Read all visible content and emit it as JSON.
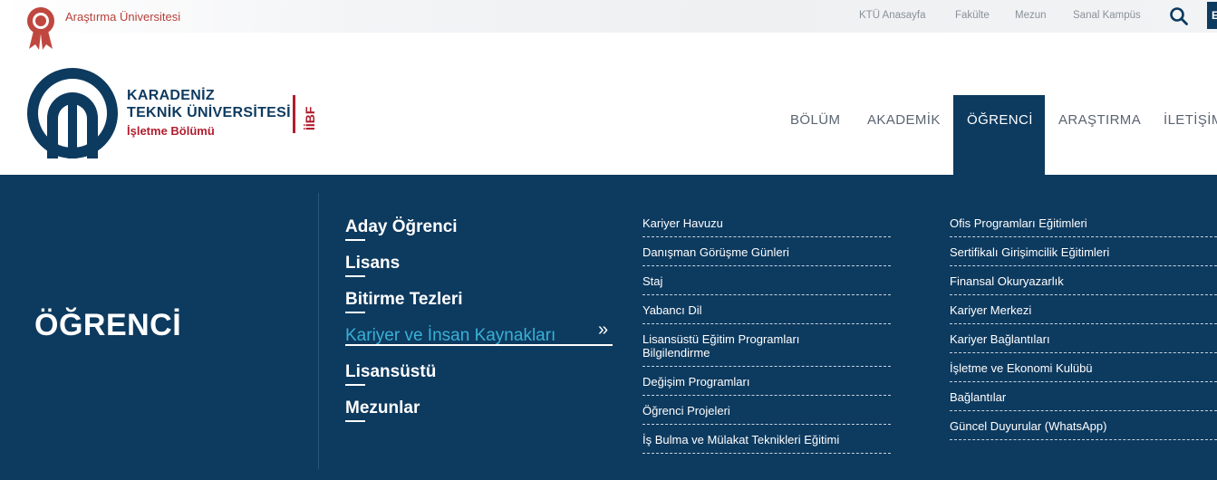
{
  "topbar": {
    "brand": "Araştırma Üniversitesi",
    "links": [
      "KTÜ Anasayfa",
      "Fakülte",
      "Mezun",
      "Sanal Kampüs"
    ],
    "lang": "E"
  },
  "header": {
    "uni_line1": "KARADENİZ",
    "uni_line2": "TEKNİK ÜNİVERSİTESİ",
    "dept": "İşletme Bölümü",
    "faculty": "İİBF"
  },
  "nav": [
    "BÖLÜM",
    "AKADEMİK",
    "ÖĞRENCİ",
    "ARAŞTIRMA",
    "İLETİŞİM"
  ],
  "panel": {
    "title": "ÖĞRENCİ",
    "main_links": [
      "Aday Öğrenci",
      "Lisans",
      "Bitirme Tezleri",
      "Kariyer ve İnsan Kaynakları",
      "Lisansüstü",
      "Mezunlar"
    ],
    "arrow": "»",
    "col1": [
      "Kariyer Havuzu",
      "Danışman Görüşme Günleri",
      "Staj",
      "Yabancı Dil",
      "Lisansüstü Eğitim Programları Bilgilendirme",
      "Değişim Programları",
      "Öğrenci Projeleri",
      "İş Bulma ve Mülakat Teknikleri Eğitimi"
    ],
    "col2": [
      "Ofis Programları Eğitimleri",
      "Sertifikalı Girişimcilik Eğitimleri",
      "Finansal Okuryazarlık",
      "Kariyer Merkezi",
      "Kariyer Bağlantıları",
      "İşletme ve Ekonomi Kulübü",
      "Bağlantılar",
      "Güncel Duyurular (WhatsApp)"
    ]
  },
  "colors": {
    "navy": "#0d3a5f",
    "brand_red": "#b01e2f",
    "active_link": "#3ab0d6"
  }
}
